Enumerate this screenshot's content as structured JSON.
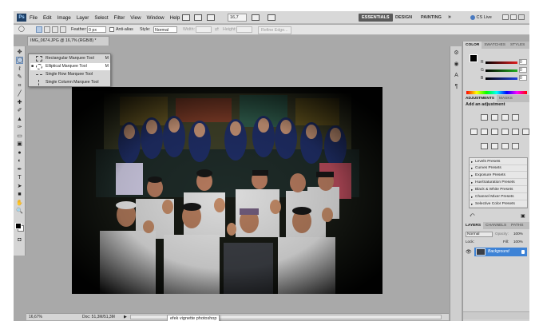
{
  "menubar": {
    "logo": "Ps",
    "items": [
      "File",
      "Edit",
      "Image",
      "Layer",
      "Select",
      "Filter",
      "View",
      "Window",
      "Help"
    ],
    "zoom": "16,7",
    "workspaces": [
      "ESSENTIALS",
      "DESIGN",
      "PAINTING"
    ],
    "overflow": "»",
    "cs_live": "CS Live"
  },
  "options": {
    "feather_label": "Feather:",
    "feather_value": "0 px",
    "antialias_label": "Anti-alias",
    "style_label": "Style:",
    "style_value": "Normal",
    "width_label": "Width:",
    "height_label": "Height:",
    "refine_label": "Refine Edge..."
  },
  "document": {
    "tab_title": "IMG_0674.JPG @ 16,7% (RGB/8) *",
    "status_zoom": "16,67%",
    "status_doc": "Doc: 51,3M/51,3M",
    "caption": "efek vignette photoshop"
  },
  "flyout": {
    "items": [
      {
        "label": "Rectangular Marquee Tool",
        "key": "M",
        "bullet": ""
      },
      {
        "label": "Elliptical Marquee Tool",
        "key": "M",
        "bullet": "■"
      },
      {
        "label": "Single Row Marquee Tool",
        "key": "",
        "bullet": ""
      },
      {
        "label": "Single Column Marquee Tool",
        "key": "",
        "bullet": ""
      }
    ]
  },
  "color_panel": {
    "tabs": [
      "COLOR",
      "SWATCHES",
      "STYLES"
    ],
    "channels": [
      {
        "label": "R",
        "value": "0",
        "color": "#e02020"
      },
      {
        "label": "G",
        "value": "0",
        "color": "#20b020"
      },
      {
        "label": "B",
        "value": "0",
        "color": "#2040e0"
      }
    ]
  },
  "adjustments_panel": {
    "tabs": [
      "ADJUSTMENTS",
      "MASKS"
    ],
    "title": "Add an adjustment",
    "presets": [
      "Levels Presets",
      "Curves Presets",
      "Exposure Presets",
      "Hue/Saturation Presets",
      "Black & White Presets",
      "Channel Mixer Presets",
      "Selective Color Presets"
    ]
  },
  "layers_panel": {
    "tabs": [
      "LAYERS",
      "CHANNELS",
      "PATHS"
    ],
    "blend_mode": "Normal",
    "opacity_label": "Opacity:",
    "opacity_value": "100%",
    "lock_label": "Lock:",
    "fill_label": "Fill:",
    "fill_value": "100%",
    "layer_name": "Background"
  },
  "colors": {
    "accent": "#3e83d6",
    "app_bg": "#a9a9a9"
  }
}
